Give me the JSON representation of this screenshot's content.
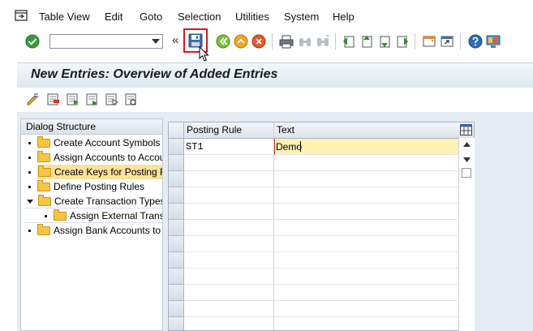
{
  "menu": {
    "items": [
      "Table View",
      "Edit",
      "Goto",
      "Selection",
      "Utilities",
      "System",
      "Help"
    ]
  },
  "toolbar": {
    "command_value": "",
    "collapse_symbol": "«"
  },
  "screen": {
    "title": "New Entries: Overview of Added Entries"
  },
  "dialog_structure": {
    "header": "Dialog Structure",
    "nodes": [
      {
        "label": "Create Account Symbols",
        "level": 0,
        "expanded": false,
        "selected": false
      },
      {
        "label": "Assign Accounts to Account Symbol",
        "level": 0,
        "expanded": false,
        "selected": false
      },
      {
        "label": "Create Keys for Posting Rules",
        "level": 0,
        "expanded": false,
        "selected": true
      },
      {
        "label": "Define Posting Rules",
        "level": 0,
        "expanded": false,
        "selected": false
      },
      {
        "label": "Create Transaction Types",
        "level": 0,
        "expanded": true,
        "selected": false
      },
      {
        "label": "Assign External Transaction Types",
        "level": 1,
        "expanded": false,
        "selected": false
      },
      {
        "label": "Assign Bank Accounts to Transaction Types",
        "level": 0,
        "expanded": false,
        "selected": false
      }
    ]
  },
  "table": {
    "columns": [
      "Posting Rule",
      "Text"
    ],
    "rows": [
      {
        "posting_rule": "ST1",
        "text": "Demo"
      }
    ]
  },
  "colors": {
    "accent_border": "#d71921",
    "selection": "#fbe19a",
    "edit_cell": "#fdf1b3"
  }
}
